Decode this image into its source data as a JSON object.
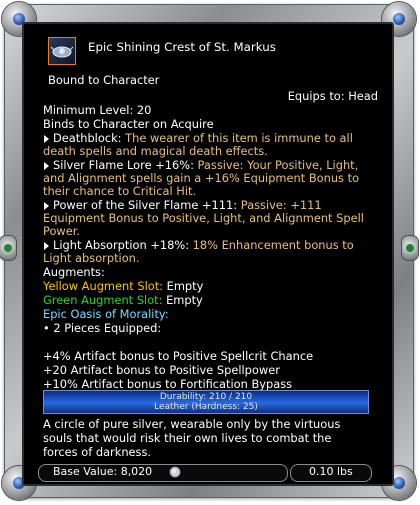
{
  "item": {
    "name": "Epic Shining Crest of St. Markus",
    "icon": "silver-crest-icon",
    "binding": "Bound to Character",
    "equips_to": "Equips to: Head",
    "minimum_level": "Minimum Level: 20",
    "binds_on": "Binds to Character on Acquire"
  },
  "effects": [
    {
      "name": "Deathblock:",
      "desc_line1": "The wearer of this item is immune to all",
      "desc_line2": "death spells and magical death effects."
    },
    {
      "name": "Silver Flame Lore +16%:",
      "desc_line1": "Passive: Your Positive, Light,",
      "desc_line2": "and Alignment spells gain a +16% Equipment Bonus to",
      "desc_line3": "their chance to Critical Hit."
    },
    {
      "name": "Power of the Silver Flame +111:",
      "desc_line1": "Passive: +111",
      "desc_line2": "Equipment Bonus to Positive, Light, and Alignment Spell",
      "desc_line3": "Power."
    },
    {
      "name": "Light Absorption +18%:",
      "desc_line1": "18% Enhancement bonus to",
      "desc_line2": "Light absorption."
    }
  ],
  "augments": {
    "header": "Augments:",
    "slots": [
      {
        "label": "Yellow Augment Slot:",
        "value": "Empty"
      },
      {
        "label": "Green Augment Slot:",
        "value": "Empty"
      }
    ]
  },
  "set": {
    "name": "Epic Oasis of Morality:",
    "pieces": "• 2 Pieces Equipped:",
    "bonuses": [
      "+4% Artifact bonus to Positive Spellcrit Chance",
      "+20 Artifact bonus to Positive Spellpower",
      "+10% Artifact bonus to Fortification Bypass"
    ]
  },
  "durability": {
    "label": "Durability: 210 / 210",
    "material": "Leather (Hardness: 25)",
    "fraction": 1.0
  },
  "description": [
    "A circle of pure silver, wearable only by the virtuous",
    "souls that would risk their own lives to combat the",
    "forces of darkness."
  ],
  "footer": {
    "base_value": "Base Value: 8,020",
    "coin_icon": "platinum-coin-icon",
    "weight": "0.10 lbs"
  },
  "colors": {
    "effect_desc": "#e7c07a",
    "yellow_slot": "#f4c600",
    "green_slot": "#33d033",
    "set_name": "#7fd8ff",
    "durability_bar": "#1d54c8",
    "icon_border": "#f07a20"
  }
}
